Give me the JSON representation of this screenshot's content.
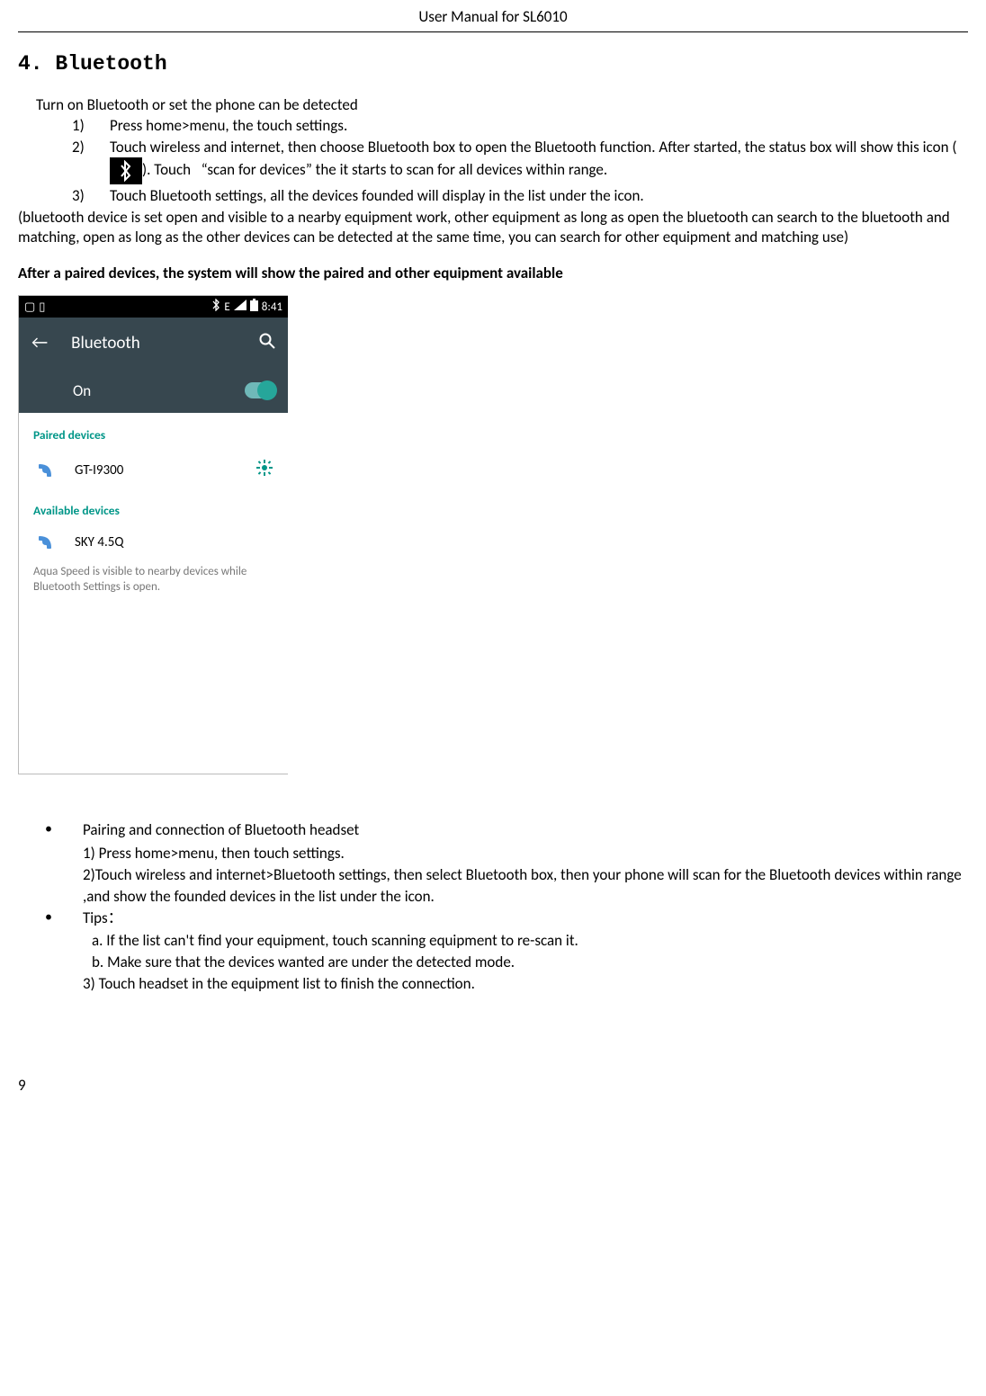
{
  "header": "User Manual for SL6010",
  "section_title": "4. Bluetooth",
  "intro": "Turn on Bluetooth or set the phone can be detected",
  "steps": {
    "s1_num": "1)",
    "s1": "Press home>menu, the touch settings.",
    "s2_num": "2)",
    "s2a": "Touch wireless and internet, then choose Bluetooth box to open the Bluetooth function. After started, the status box will show this icon (",
    "s2b": "). Touch   “scan for devices” the it starts to scan for all devices within range.",
    "s3_num": "3)",
    "s3": "Touch Bluetooth settings, all the devices founded will display in the list under the icon."
  },
  "paren": "(bluetooth device is set open and visible to a nearby equipment work, other equipment as long as open the bluetooth can search to the bluetooth and matching, open as long as the other devices can be detected at the same time, you can search for other equipment and matching use)",
  "bold": "After a paired devices, the system will show the paired and other equipment available",
  "phone": {
    "status_right": "E",
    "status_time": "8:41",
    "appbar_title": "Bluetooth",
    "on_label": "On",
    "paired_h": "Paired devices",
    "paired_dev": "GT-I9300",
    "avail_h": "Available devices",
    "avail_dev": "SKY 4.5Q",
    "note": "Aqua Speed is visible to nearby devices while Bluetooth Settings is open."
  },
  "bullets": {
    "b1": "Pairing and connection of Bluetooth headset",
    "b1_1": "1) Press home>menu, then touch settings.",
    "b1_2": "2)Touch wireless and internet>Bluetooth settings, then select Bluetooth box, then your phone will scan for the Bluetooth devices within range ,and show the founded devices in the list under the icon.",
    "b2": "Tips：",
    "b2_a": "a.  If the list can't find your equipment, touch scanning equipment to re-scan it.",
    "b2_b": "b.  Make sure that the devices wanted are under the detected mode.",
    "b2_3": "3) Touch headset in the equipment list to finish the connection."
  },
  "page_num": "9"
}
